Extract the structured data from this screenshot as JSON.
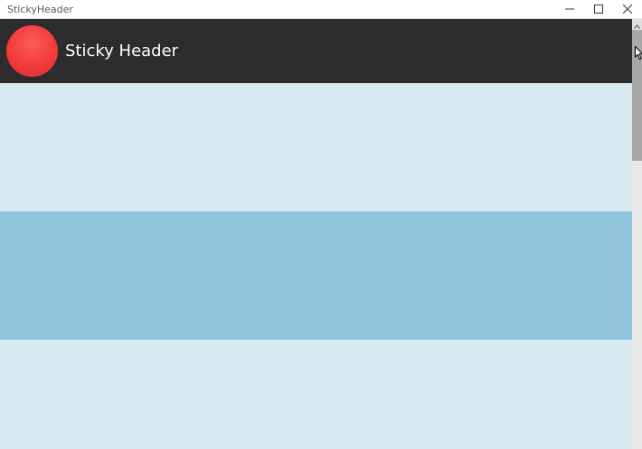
{
  "window": {
    "title": "StickyHeader",
    "controls": {
      "minimize_icon": "minimize-icon",
      "maximize_icon": "maximize-icon",
      "close_icon": "close-icon"
    }
  },
  "header": {
    "title": "Sticky Header",
    "logo_color": "#f23b3b",
    "background": "#2c2c2e"
  },
  "list": {
    "row_colors": [
      "#d9ecf3",
      "#92c5de",
      "#d9ecf3"
    ]
  },
  "scrollbar": {
    "up_icon": "chevron-up-icon"
  }
}
